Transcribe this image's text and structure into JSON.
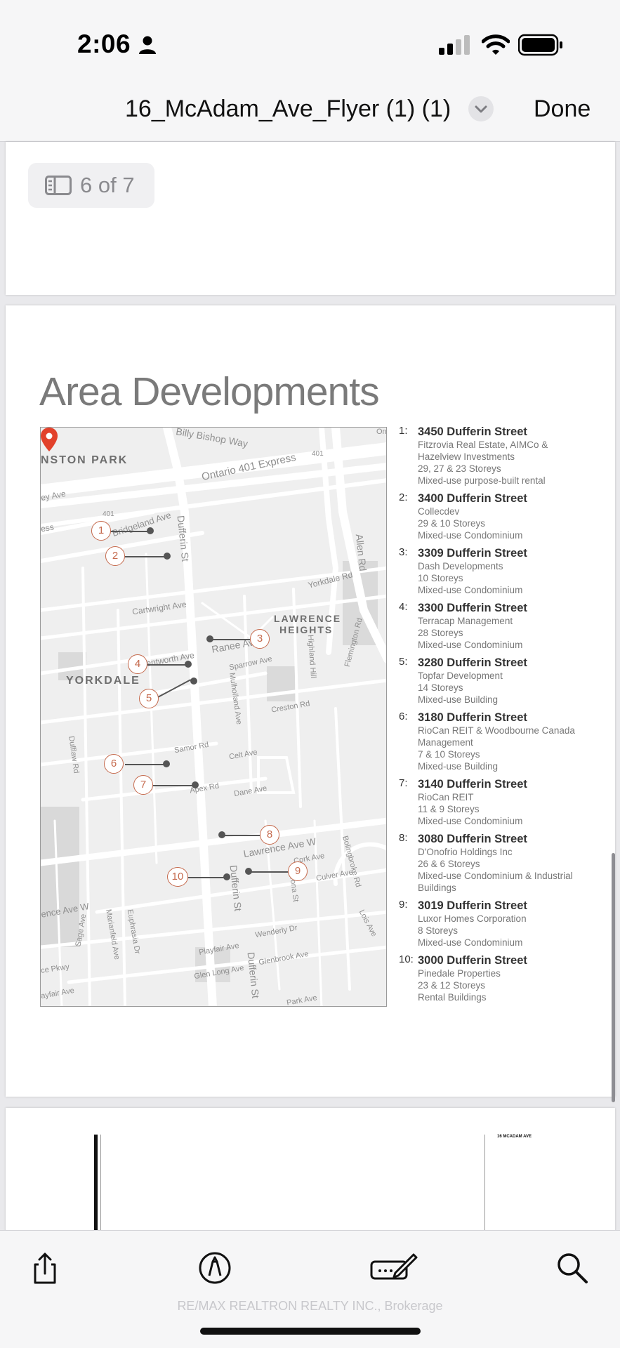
{
  "status_bar": {
    "time": "2:06",
    "icons": [
      "person-icon",
      "signal-icon",
      "wifi-icon",
      "battery-icon"
    ]
  },
  "nav": {
    "title": "16_McAdam_Ave_Flyer (1) (1)",
    "done_label": "Done"
  },
  "page_indicator": {
    "text": "6 of 7"
  },
  "page": {
    "heading": "Area Developments",
    "map": {
      "labels": [
        "Billy Bishop Way",
        "NSTON PARK",
        "Ontario 401 Express",
        "401",
        "401",
        "Bridgeland Ave",
        "ey Ave",
        "ess",
        "Dufferin St",
        "Allen Rd",
        "Yorkdale Rd",
        "Cartwright Ave",
        "LAWRENCE",
        "HEIGHTS",
        "Ranee Ave",
        "Flemington Rd",
        "Highland Hill",
        "entworth Ave",
        "Sparrow Ave",
        "YORKDALE",
        "Mulholland Ave",
        "Creston Rd",
        "Dufflaw Rd",
        "Samor Rd",
        "Celt Ave",
        "Apex Rd",
        "Dane Ave",
        "Lawrence Ave W",
        "Bolingbroke Rd",
        "Cork Ave",
        "Culver Ave",
        "Corona St",
        "Dufferin St",
        "ence Ave W",
        "Sage Ave",
        "Marianfeld Ave",
        "Euphrasia Dr",
        "Lois Ave",
        "Wenderly Dr",
        "Playfair Ave",
        "ce Pkwy",
        "Glen Long Ave",
        "Glenbrook Ave",
        "Dufferin St",
        "ayfair Ave",
        "Park Ave",
        "On"
      ],
      "markers": [
        "1",
        "2",
        "3",
        "4",
        "5",
        "6",
        "7",
        "8",
        "9",
        "10"
      ]
    },
    "developments": [
      {
        "num": "1:",
        "address": "3450 Dufferin Street",
        "lines": [
          "Fitzrovia Real Estate, AIMCo &",
          "Hazelview Investments",
          "29, 27 & 23 Storeys",
          "Mixed-use purpose-built rental"
        ]
      },
      {
        "num": "2:",
        "address": "3400 Dufferin Street",
        "lines": [
          "Collecdev",
          "29 & 10 Storeys",
          "Mixed-use Condominium"
        ]
      },
      {
        "num": "3:",
        "address": "3309 Dufferin Street",
        "lines": [
          "Dash Developments",
          "10 Storeys",
          "Mixed-use Condominium"
        ]
      },
      {
        "num": "4:",
        "address": "3300 Dufferin Street",
        "lines": [
          "Terracap Management",
          "28 Storeys",
          "Mixed-use Condominium"
        ]
      },
      {
        "num": "5:",
        "address": "3280 Dufferin Street",
        "lines": [
          "Topfar Development",
          "14 Storeys",
          "Mixed-use Building"
        ]
      },
      {
        "num": "6:",
        "address": "3180 Dufferin Street",
        "lines": [
          "RioCan REIT & Woodbourne Canada",
          "Management",
          "7 & 10 Storeys",
          "Mixed-use Building"
        ]
      },
      {
        "num": "7:",
        "address": "3140 Dufferin Street",
        "lines": [
          "RioCan REIT",
          "11 & 9 Storeys",
          "Mixed-use Condominium"
        ]
      },
      {
        "num": "8:",
        "address": "3080 Dufferin Street",
        "lines": [
          "D'Onofrio Holdings Inc",
          "26 & 6 Storeys",
          "Mixed-use Condominium & Industrial",
          "Buildings"
        ]
      },
      {
        "num": "9:",
        "address": "3019 Dufferin Street",
        "lines": [
          "Luxor Homes Corporation",
          "8 Storeys",
          "Mixed-use Condominium"
        ]
      },
      {
        "num": "10:",
        "address": "3000 Dufferin Street",
        "lines": [
          "Pinedale Properties",
          "23 & 12 Storeys",
          "Rental Buildings"
        ]
      }
    ]
  },
  "next_page_thumb": {
    "text": "16 MCADAM AVE"
  },
  "toolbar": {
    "icons": [
      "share-icon",
      "markup-icon",
      "signature-icon",
      "search-icon"
    ]
  },
  "watermark": "RE/MAX REALTRON REALTY INC., Brokerage"
}
